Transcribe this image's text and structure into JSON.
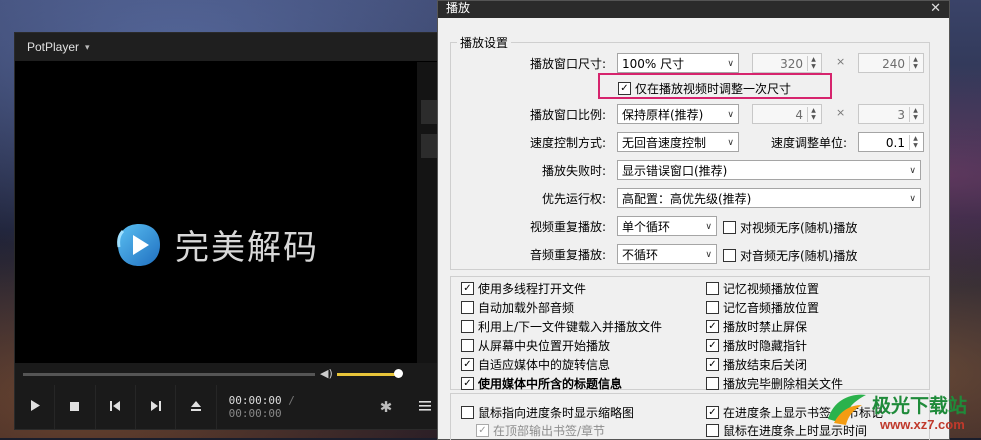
{
  "player": {
    "title": "PotPlayer",
    "logo_text": "完美解码",
    "time_current": "00:00:00",
    "time_sep": "/",
    "time_total": "00:00:00",
    "volume_level": 0.95
  },
  "dialog": {
    "title": "播放",
    "group_title": "播放设置",
    "rows": {
      "window_size_label": "播放窗口尺寸:",
      "window_size_value": "100% 尺寸",
      "width": "320",
      "height": "240",
      "times": "×",
      "resize_once_label": "仅在播放视频时调整一次尺寸",
      "aspect_label": "播放窗口比例:",
      "aspect_value": "保持原样(推荐)",
      "aspect_w": "4",
      "aspect_h": "3",
      "speed_mode_label": "速度控制方式:",
      "speed_mode_value": "无回音速度控制",
      "speed_unit_label": "速度调整单位:",
      "speed_unit_value": "0.1",
      "fail_label": "播放失败时:",
      "fail_value": "显示错误窗口(推荐)",
      "priority_label": "优先运行权:",
      "priority_value": "高配置：高优先级(推荐)",
      "video_repeat_label": "视频重复播放:",
      "video_repeat_value": "单个循环",
      "video_shuffle_label": "对视频无序(随机)播放",
      "audio_repeat_label": "音频重复播放:",
      "audio_repeat_value": "不循环",
      "audio_shuffle_label": "对音频无序(随机)播放"
    },
    "options_left": [
      {
        "label": "使用多线程打开文件",
        "checked": true
      },
      {
        "label": "自动加载外部音频",
        "checked": false
      },
      {
        "label": "利用上/下一文件键载入并播放文件",
        "checked": false
      },
      {
        "label": "从屏幕中央位置开始播放",
        "checked": false
      },
      {
        "label": "自适应媒体中的旋转信息",
        "checked": true
      },
      {
        "label": "使用媒体中所含的标题信息",
        "checked": true
      }
    ],
    "options_right": [
      {
        "label": "记忆视频播放位置",
        "checked": false
      },
      {
        "label": "记忆音频播放位置",
        "checked": false
      },
      {
        "label": "播放时禁止屏保",
        "checked": true
      },
      {
        "label": "播放时隐藏指针",
        "checked": true
      },
      {
        "label": "播放结束后关闭",
        "checked": true
      },
      {
        "label": "播放完毕删除相关文件",
        "checked": false
      }
    ],
    "bottom_left": [
      {
        "label": "鼠标指向进度条时显示缩略图",
        "checked": false
      },
      {
        "label": "在顶部输出书签/章节",
        "checked": true
      }
    ],
    "bottom_right": [
      {
        "label": "在进度条上显示书签/章节标记",
        "checked": true
      },
      {
        "label": "鼠标在进度条上时显示时间",
        "checked": false
      }
    ]
  },
  "watermark": {
    "brand": "极光下载站",
    "url": "www.xz7.com"
  },
  "colors": {
    "highlight": "#d6246d",
    "volume": "#e8c53a",
    "logo_blue": "#2a8fd8"
  }
}
